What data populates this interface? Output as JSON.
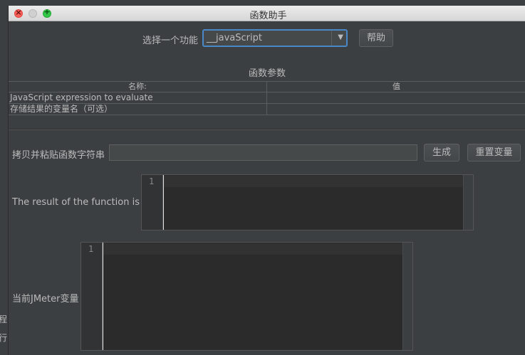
{
  "window": {
    "title": "函数助手"
  },
  "function_selector": {
    "label": "选择一个功能",
    "selected": "__javaScript",
    "help_button": "帮助"
  },
  "params": {
    "heading": "函数参数",
    "columns": [
      "名称:",
      "值"
    ],
    "rows": [
      {
        "name": "JavaScript expression to evaluate",
        "value": ""
      },
      {
        "name": "存储结果的变量名（可选）",
        "value": ""
      }
    ]
  },
  "copy_section": {
    "label": "拷贝并粘贴函数字符串",
    "input_value": "",
    "generate_button": "生成",
    "reset_button": "重置变量"
  },
  "result_section": {
    "label": "The result of the function is",
    "line_number": "1"
  },
  "jmeter_vars": {
    "label": "当前JMeter变量",
    "line_number": "1"
  },
  "background_fragments": [
    "程",
    "行"
  ],
  "colors": {
    "background": "#3c3f41",
    "editor_bg": "#2b2b2b",
    "focus_border": "#4a88c7",
    "text": "#bbbbbb"
  }
}
